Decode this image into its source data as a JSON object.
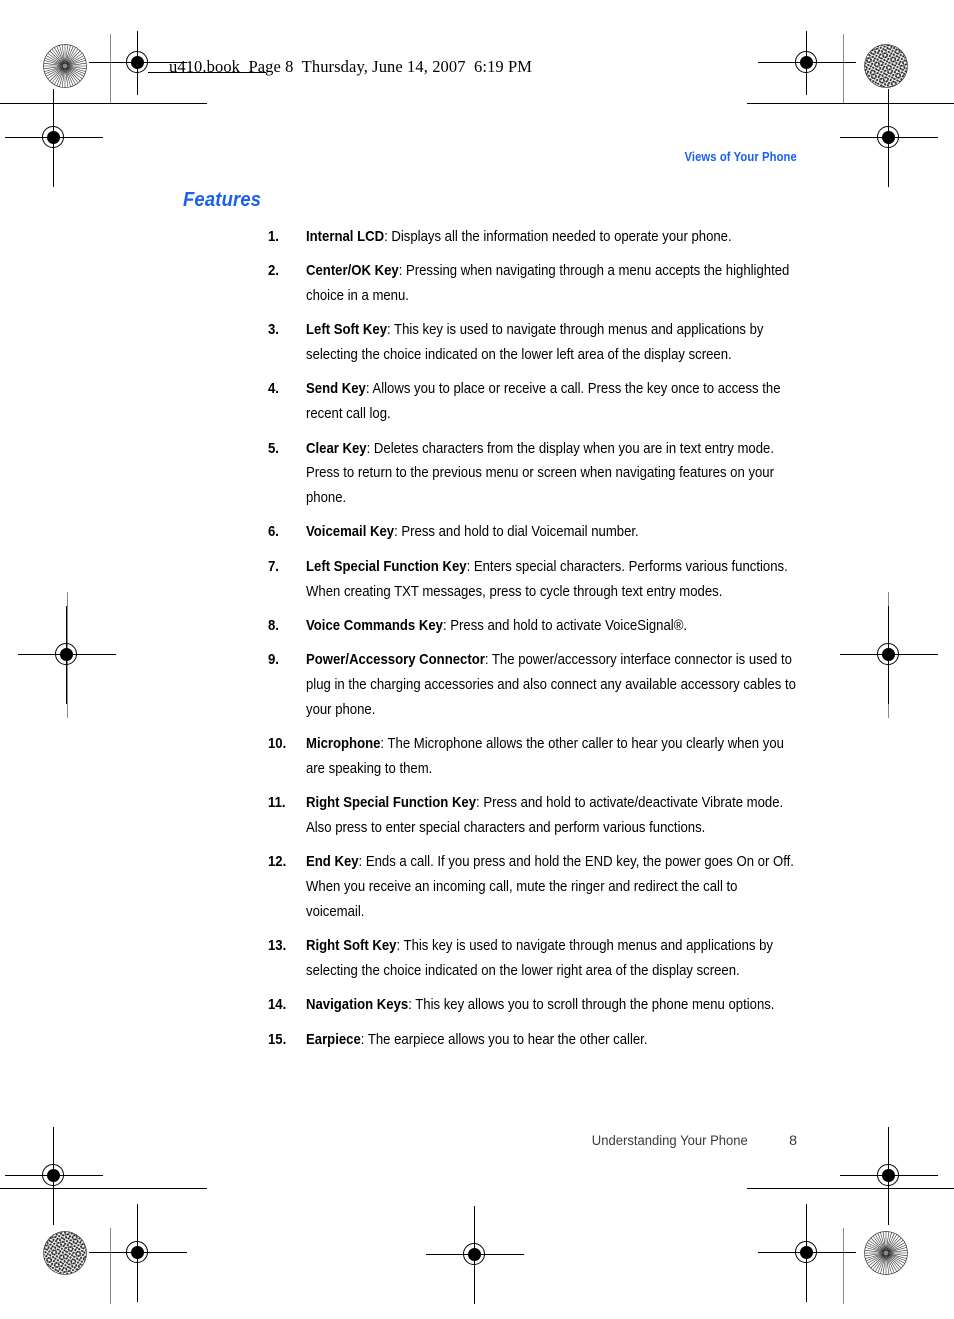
{
  "print_header": {
    "filename_line": "u410.book  Page 8  Thursday, June 14, 2007  6:19 PM"
  },
  "running_head": "Views of Your Phone",
  "section_title": "Features",
  "colors": {
    "accent_blue": "#1b5ff0",
    "body_text": "#000000",
    "footer_text": "#3a3a3a"
  },
  "features": [
    {
      "number": "1.",
      "term": "Internal LCD",
      "description": ": Displays all the information needed to operate your phone."
    },
    {
      "number": "2.",
      "term": "Center/OK Key",
      "description": ": Pressing when navigating through a menu accepts the highlighted choice in a menu."
    },
    {
      "number": "3.",
      "term": "Left Soft Key",
      "description": ": This key is used to navigate through menus and applications by selecting the choice indicated on the lower left area of the display screen."
    },
    {
      "number": "4.",
      "term": "Send Key",
      "description": ": Allows you to place or receive a call. Press the key once to access the recent call log."
    },
    {
      "number": "5.",
      "term": "Clear Key",
      "description": ": Deletes characters from the display when you are in text entry mode. Press to return to the previous menu or screen when navigating features on your phone."
    },
    {
      "number": "6.",
      "term": "Voicemail Key",
      "description": ": Press and hold to dial Voicemail number."
    },
    {
      "number": "7.",
      "term": "Left Special Function Key",
      "description": ": Enters special characters. Performs various functions. When creating TXT messages, press to cycle through text entry modes."
    },
    {
      "number": "8.",
      "term": "Voice Commands Key",
      "description": ": Press and hold to activate VoiceSignal®."
    },
    {
      "number": "9.",
      "term": "Power/Accessory Connector",
      "description": ": The power/accessory interface connector is used to plug in the charging accessories and also connect any available accessory cables to your phone."
    },
    {
      "number": "10.",
      "term": "Microphone",
      "description": ": The Microphone allows the other caller to hear you clearly when you are speaking to them."
    },
    {
      "number": "11.",
      "term": "Right Special Function Key",
      "description": ": Press and hold to activate/deactivate Vibrate mode. Also press to enter special characters and perform various functions."
    },
    {
      "number": "12.",
      "term": "End Key",
      "description": ": Ends a call. If you press and hold the END key, the power goes On or Off. When you receive an incoming call, mute the ringer and redirect the call to voicemail."
    },
    {
      "number": "13.",
      "term": "Right Soft Key",
      "description": ": This key is used to navigate through menus and applications by selecting the choice indicated on the lower right area of the display screen."
    },
    {
      "number": "14.",
      "term": "Navigation Keys",
      "description": ": This key allows you to scroll through the phone menu options."
    },
    {
      "number": "15.",
      "term": "Earpiece",
      "description": ": The earpiece allows you to hear the other caller."
    }
  ],
  "footer": {
    "chapter": "Understanding Your Phone",
    "page_number": "8"
  }
}
